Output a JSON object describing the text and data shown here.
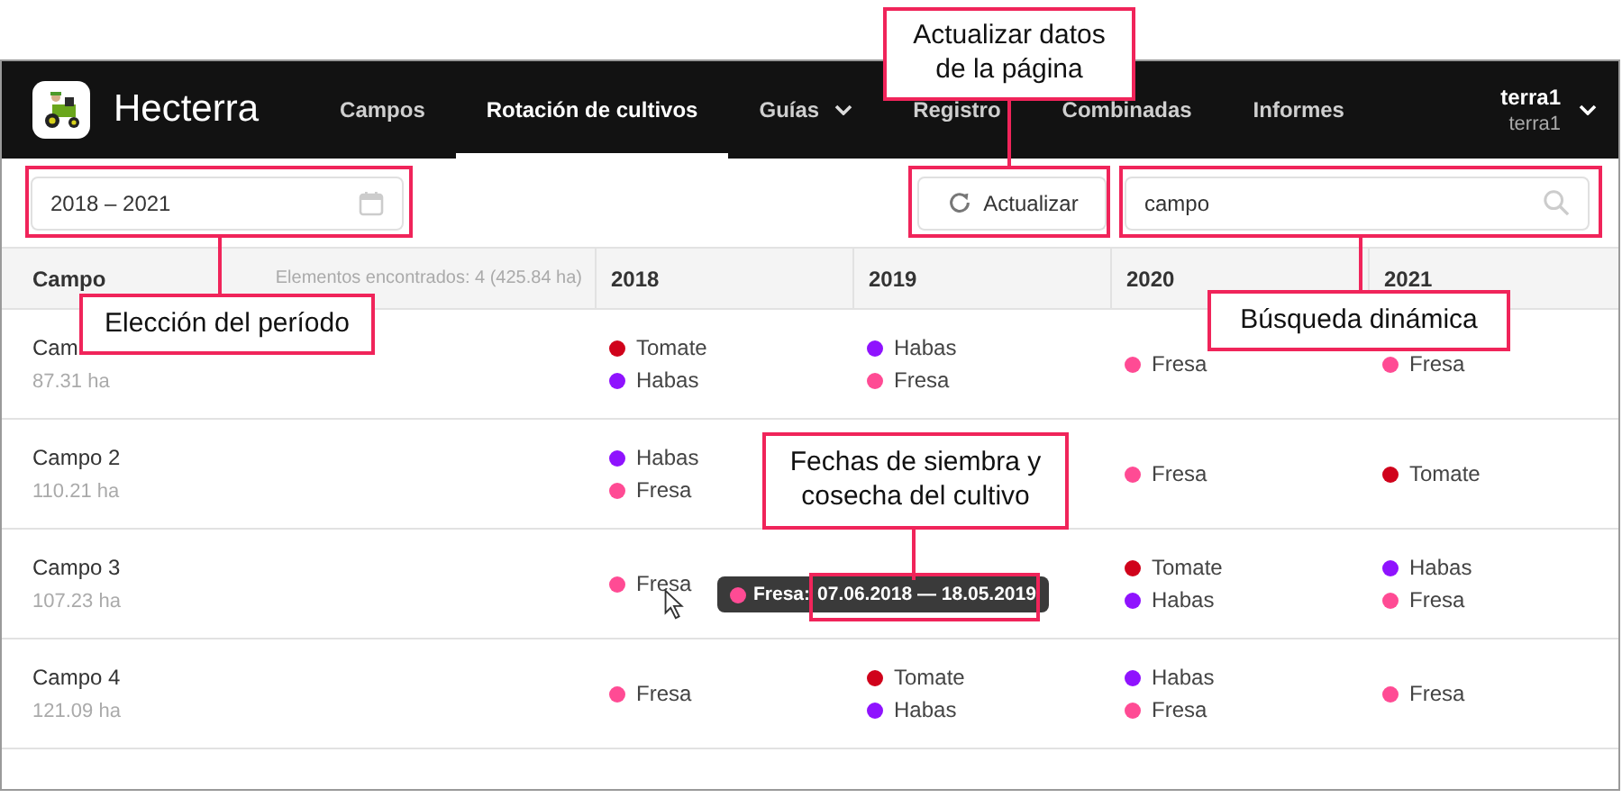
{
  "app": {
    "name": "Hecterra"
  },
  "nav": [
    {
      "label": "Campos",
      "selected": false,
      "dropdown": false
    },
    {
      "label": "Rotación de cultivos",
      "selected": true,
      "dropdown": false
    },
    {
      "label": "Guías",
      "selected": false,
      "dropdown": true
    },
    {
      "label": "Registro",
      "selected": false,
      "dropdown": false
    },
    {
      "label": "Combinadas",
      "selected": false,
      "dropdown": false
    },
    {
      "label": "Informes",
      "selected": false,
      "dropdown": false
    }
  ],
  "user": {
    "name": "terra1",
    "account": "terra1"
  },
  "toolbar": {
    "period": "2018 – 2021",
    "refresh_label": "Actualizar",
    "search_value": "campo"
  },
  "table": {
    "first_column": "Campo",
    "found": "Elementos encontrados: 4 (425.84 ha)",
    "years": [
      "2018",
      "2019",
      "2020",
      "2021"
    ],
    "rows": [
      {
        "name": "Cam",
        "area": "87.31 ha",
        "cells": [
          {
            "crops": [
              {
                "name": "Tomate",
                "color": "#d0021b"
              },
              {
                "name": "Habas",
                "color": "#8f13fe"
              }
            ]
          },
          {
            "crops": [
              {
                "name": "Habas",
                "color": "#8f13fe"
              },
              {
                "name": "Fresa",
                "color": "#ff4b94"
              }
            ]
          },
          {
            "crops": [
              {
                "name": "Fresa",
                "color": "#ff4b94"
              }
            ]
          },
          {
            "crops": [
              {
                "name": "Fresa",
                "color": "#ff4b94"
              }
            ]
          }
        ]
      },
      {
        "name": "Campo 2",
        "area": "110.21 ha",
        "cells": [
          {
            "crops": [
              {
                "name": "Habas",
                "color": "#8f13fe"
              },
              {
                "name": "Fresa",
                "color": "#ff4b94"
              }
            ]
          },
          {},
          {
            "crops": [
              {
                "name": "Fresa",
                "color": "#ff4b94"
              }
            ]
          },
          {
            "crops": [
              {
                "name": "Tomate",
                "color": "#d0021b"
              }
            ]
          }
        ]
      },
      {
        "name": "Campo 3",
        "area": "107.23 ha",
        "cells": [
          {
            "crops": [
              {
                "name": "Fresa",
                "color": "#ff4b94"
              }
            ]
          },
          {
            "tooltip": {
              "label": "Fresa:",
              "dates": "07.06.2018 — 18.05.2019",
              "color": "#ff4b94"
            }
          },
          {
            "crops": [
              {
                "name": "Tomate",
                "color": "#d0021b"
              },
              {
                "name": "Habas",
                "color": "#8f13fe"
              }
            ]
          },
          {
            "crops": [
              {
                "name": "Habas",
                "color": "#8f13fe"
              },
              {
                "name": "Fresa",
                "color": "#ff4b94"
              }
            ]
          }
        ]
      },
      {
        "name": "Campo 4",
        "area": "121.09 ha",
        "cells": [
          {
            "crops": [
              {
                "name": "Fresa",
                "color": "#ff4b94"
              }
            ]
          },
          {
            "crops": [
              {
                "name": "Tomate",
                "color": "#d0021b"
              },
              {
                "name": "Habas",
                "color": "#8f13fe"
              }
            ]
          },
          {
            "crops": [
              {
                "name": "Habas",
                "color": "#8f13fe"
              },
              {
                "name": "Fresa",
                "color": "#ff4b94"
              }
            ]
          },
          {
            "crops": [
              {
                "name": "Fresa",
                "color": "#ff4b94"
              }
            ]
          }
        ]
      }
    ]
  },
  "annotations": [
    "Actualizar datos de la página",
    "Elección del período",
    "Búsqueda dinámica",
    "Fechas de siembra y cosecha del cultivo"
  ]
}
